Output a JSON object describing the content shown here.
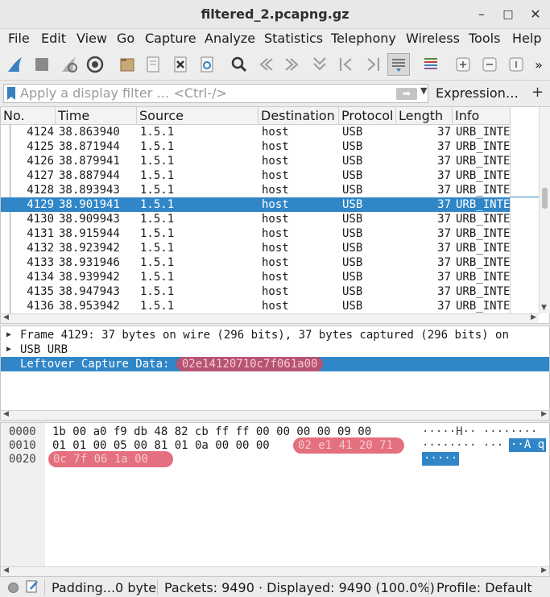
{
  "window": {
    "title": "filtered_2.pcapng.gz",
    "minimize_glyph": "–",
    "maximize_glyph": "□",
    "close_glyph": "✕"
  },
  "menu": {
    "file": "File",
    "edit": "Edit",
    "view": "View",
    "go": "Go",
    "capture": "Capture",
    "analyze": "Analyze",
    "statistics": "Statistics",
    "telephony": "Telephony",
    "wireless": "Wireless",
    "tools": "Tools",
    "help": "Help"
  },
  "toolbar": {
    "overflow_glyph": "»",
    "icons": [
      "shark-fin-start-icon",
      "stop-capture-icon",
      "restart-capture-icon",
      "capture-options-icon",
      "open-file-icon",
      "save-file-icon",
      "close-file-icon",
      "reload-file-icon",
      "find-packet-icon",
      "go-back-icon",
      "go-forward-icon",
      "go-to-packet-icon",
      "first-packet-icon",
      "last-packet-icon",
      "auto-scroll-icon",
      "colorize-icon",
      "zoom-in-icon",
      "zoom-out-icon",
      "normal-size-icon"
    ]
  },
  "filter": {
    "placeholder": "Apply a display filter … <Ctrl-/>",
    "apply_glyph": "➡",
    "dropdown_glyph": "▼",
    "expression_label": "Expression…",
    "add_glyph": "+"
  },
  "packet_list": {
    "columns": {
      "no": "No.",
      "time": "Time",
      "source": "Source",
      "destination": "Destination",
      "protocol": "Protocol",
      "length": "Length",
      "info": "Info"
    },
    "rows": [
      {
        "no": "4124",
        "time": "38.863940",
        "source": "1.5.1",
        "destination": "host",
        "protocol": "USB",
        "length": "37",
        "info": "URB_INTERRUPT in"
      },
      {
        "no": "4125",
        "time": "38.871944",
        "source": "1.5.1",
        "destination": "host",
        "protocol": "USB",
        "length": "37",
        "info": "URB_INTERRUPT in"
      },
      {
        "no": "4126",
        "time": "38.879941",
        "source": "1.5.1",
        "destination": "host",
        "protocol": "USB",
        "length": "37",
        "info": "URB_INTERRUPT in"
      },
      {
        "no": "4127",
        "time": "38.887944",
        "source": "1.5.1",
        "destination": "host",
        "protocol": "USB",
        "length": "37",
        "info": "URB_INTERRUPT in"
      },
      {
        "no": "4128",
        "time": "38.893943",
        "source": "1.5.1",
        "destination": "host",
        "protocol": "USB",
        "length": "37",
        "info": "URB_INTERRUPT in"
      },
      {
        "no": "4129",
        "time": "38.901941",
        "source": "1.5.1",
        "destination": "host",
        "protocol": "USB",
        "length": "37",
        "info": "URB_INTERRUPT in"
      },
      {
        "no": "4130",
        "time": "38.909943",
        "source": "1.5.1",
        "destination": "host",
        "protocol": "USB",
        "length": "37",
        "info": "URB_INTERRUPT in"
      },
      {
        "no": "4131",
        "time": "38.915944",
        "source": "1.5.1",
        "destination": "host",
        "protocol": "USB",
        "length": "37",
        "info": "URB_INTERRUPT in"
      },
      {
        "no": "4132",
        "time": "38.923942",
        "source": "1.5.1",
        "destination": "host",
        "protocol": "USB",
        "length": "37",
        "info": "URB_INTERRUPT in"
      },
      {
        "no": "4133",
        "time": "38.931946",
        "source": "1.5.1",
        "destination": "host",
        "protocol": "USB",
        "length": "37",
        "info": "URB_INTERRUPT in"
      },
      {
        "no": "4134",
        "time": "38.939942",
        "source": "1.5.1",
        "destination": "host",
        "protocol": "USB",
        "length": "37",
        "info": "URB_INTERRUPT in"
      },
      {
        "no": "4135",
        "time": "38.947943",
        "source": "1.5.1",
        "destination": "host",
        "protocol": "USB",
        "length": "37",
        "info": "URB_INTERRUPT in"
      },
      {
        "no": "4136",
        "time": "38.953942",
        "source": "1.5.1",
        "destination": "host",
        "protocol": "USB",
        "length": "37",
        "info": "URB_INTERRUPT in"
      }
    ],
    "selected_no": "4129"
  },
  "details": {
    "frame": "Frame 4129: 37 bytes on wire (296 bits), 37 bytes captured (296 bits) on",
    "usb_urb": "USB URB",
    "leftover_label": "Leftover Capture Data: ",
    "leftover_value": "02e14120710c7f061a00",
    "expand_glyph": "▶"
  },
  "bytes": {
    "rows": [
      {
        "offset": "0000",
        "hex": "1b 00 a0 f9 db 48 82 cb  ff ff 00 00 00 00 09 00",
        "ascii": "·····H·· ········"
      },
      {
        "offset": "0010",
        "hex": "01 01 00 05 00 81 01 0a  00 00 00",
        "ascii": "········ ···"
      },
      {
        "offset": "0020",
        "hex": "",
        "ascii": ""
      }
    ],
    "hl_hex_1": "02 e1 41 20 71",
    "hl_hex_2": "0c 7f 06 1a 00",
    "hl_ascii_1": "··A q",
    "hl_ascii_2": "·····"
  },
  "status": {
    "field": "Padding...0 byte",
    "packets": "Packets: 9490 · Displayed: 9490 (100.0%)",
    "profile": "Profile: Default"
  },
  "colors": {
    "selection": "#3086c7",
    "highlight": "#dc465a",
    "shark_blue": "#3a7fc1"
  }
}
